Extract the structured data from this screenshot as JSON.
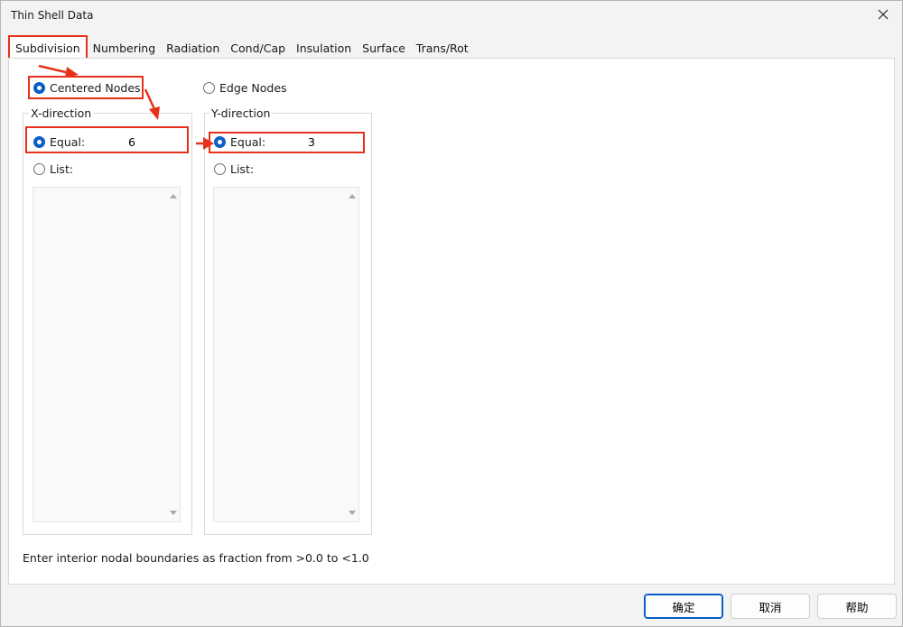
{
  "window": {
    "title": "Thin Shell Data"
  },
  "tabs": [
    {
      "label": "Subdivision",
      "active": true
    },
    {
      "label": "Numbering"
    },
    {
      "label": "Radiation"
    },
    {
      "label": "Cond/Cap"
    },
    {
      "label": "Insulation"
    },
    {
      "label": "Surface"
    },
    {
      "label": "Trans/Rot"
    }
  ],
  "node_mode": {
    "centered_label": "Centered Nodes",
    "edge_label": "Edge Nodes",
    "selected": "centered"
  },
  "x_direction": {
    "label": "X-direction",
    "equal_label": "Equal:",
    "equal_value": "6",
    "list_label": "List:",
    "selected": "equal"
  },
  "y_direction": {
    "label": "Y-direction",
    "equal_label": "Equal:",
    "equal_value": "3",
    "list_label": "List:",
    "selected": "equal"
  },
  "hint": "Enter interior nodal boundaries as fraction from >0.0 to <1.0",
  "buttons": {
    "ok": "确定",
    "cancel": "取消",
    "help": "帮助"
  },
  "colors": {
    "highlight": "#e8311a",
    "accent": "#0a5fc4"
  }
}
